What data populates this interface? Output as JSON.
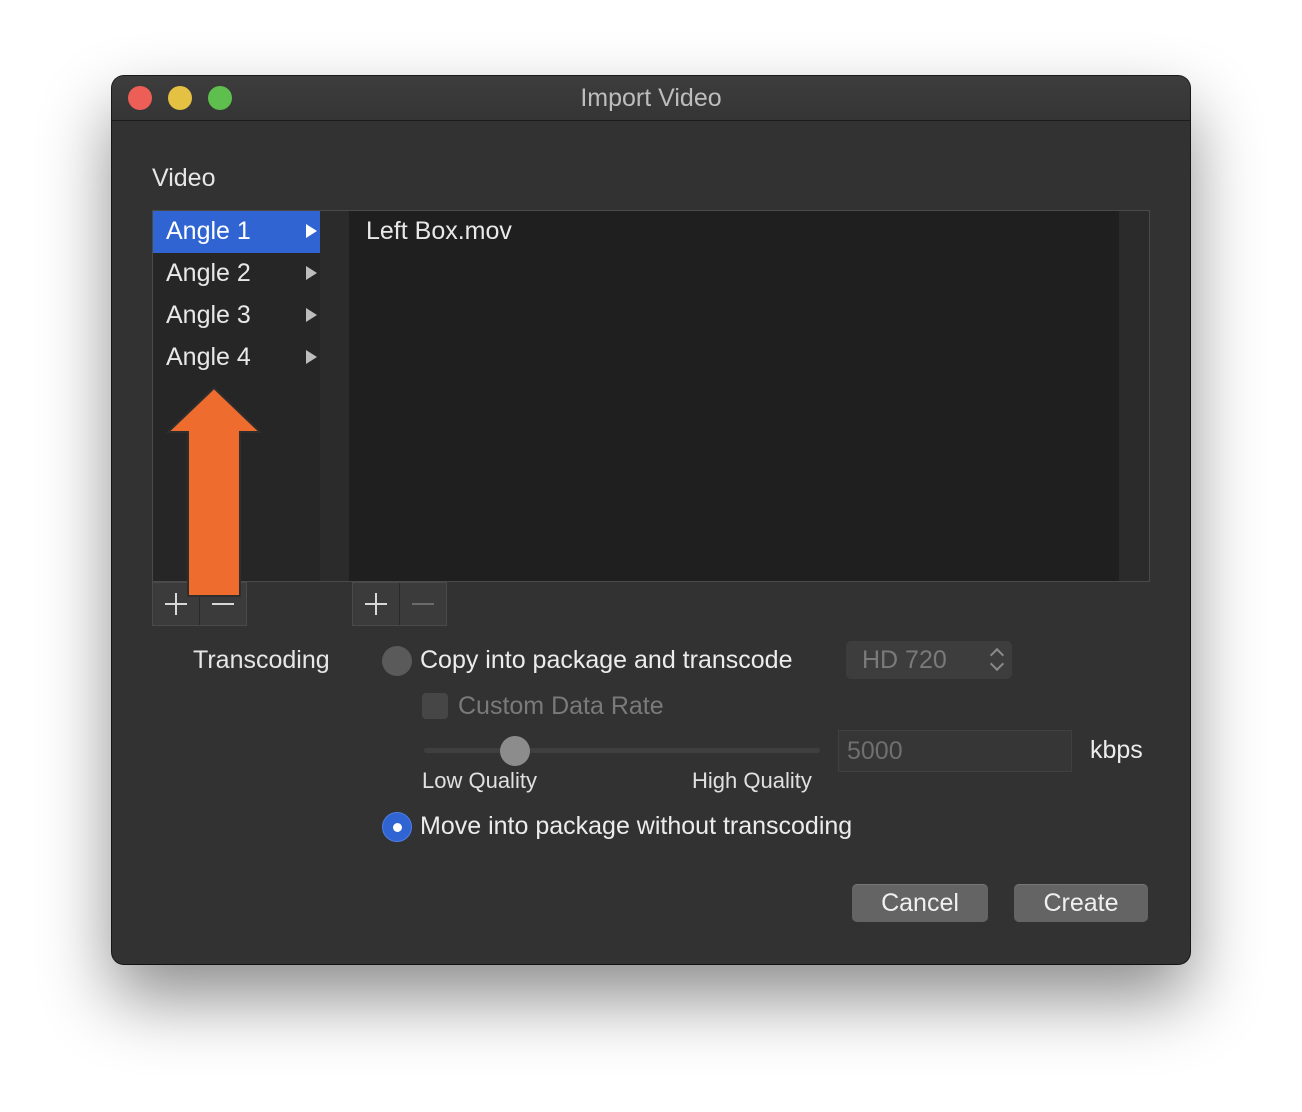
{
  "window": {
    "title": "Import Video"
  },
  "video": {
    "section_label": "Video",
    "angles": [
      "Angle 1",
      "Angle 2",
      "Angle 3",
      "Angle 4"
    ],
    "selected_angle": "Angle 1",
    "files": [
      "Left Box.mov"
    ]
  },
  "transcoding": {
    "label": "Transcoding",
    "copy_option": "Copy into package and transcode",
    "preset_value": "HD 720",
    "custom_rate_label": "Custom Data Rate",
    "slider_low": "Low Quality",
    "slider_high": "High Quality",
    "quality_level": 0.23,
    "data_rate_value": "5000",
    "data_rate_unit": "kbps",
    "move_option": "Move into package without transcoding",
    "selected_option": "move"
  },
  "buttons": {
    "cancel": "Cancel",
    "create": "Create"
  },
  "colors": {
    "accent": "#2f64d2",
    "annotation_arrow": "#ee6c2d"
  }
}
